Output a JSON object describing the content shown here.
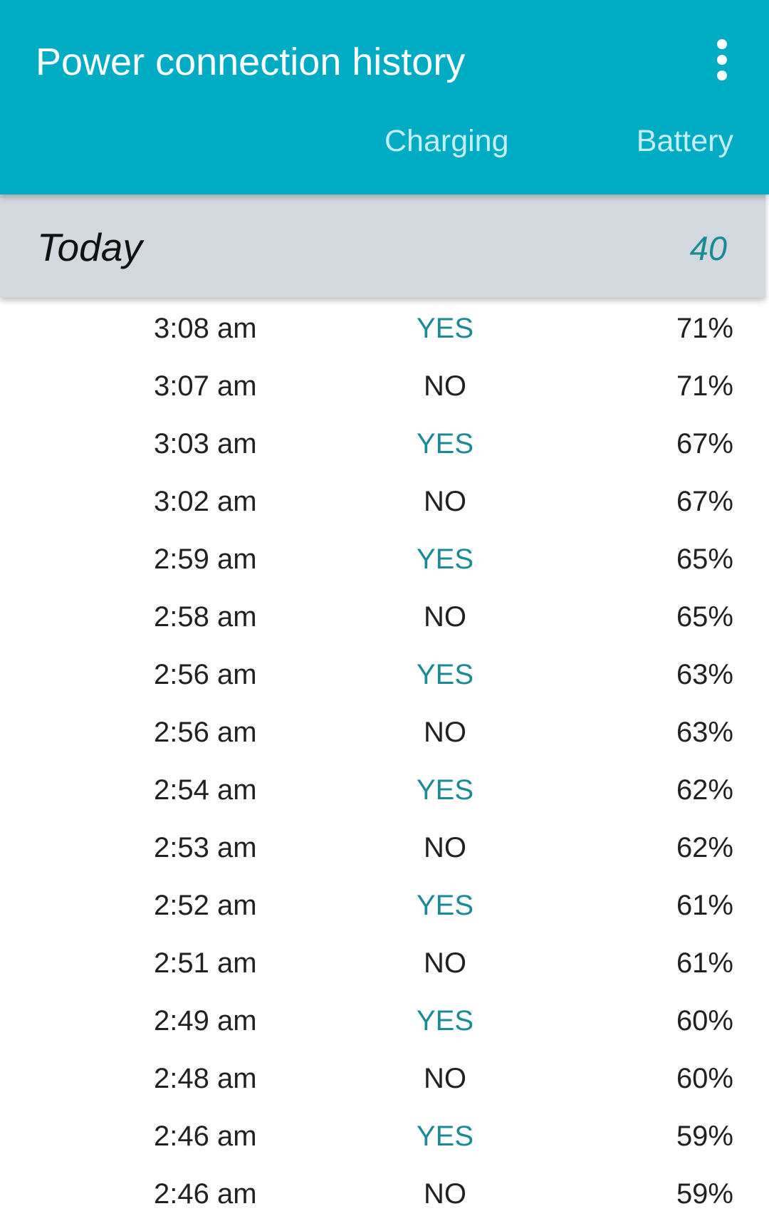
{
  "appbar": {
    "title": "Power connection history",
    "menu_icon": "more-vert-icon",
    "columns": {
      "charging": "Charging",
      "battery": "Battery"
    }
  },
  "colors": {
    "appbar": "#00acc4",
    "section_bg": "#d1d8de",
    "accent": "#1c8a96"
  },
  "section": {
    "title": "Today",
    "count": "40"
  },
  "rows": [
    {
      "time": "3:08 am",
      "charging": "YES",
      "battery": "71%"
    },
    {
      "time": "3:07 am",
      "charging": "NO",
      "battery": "71%"
    },
    {
      "time": "3:03 am",
      "charging": "YES",
      "battery": "67%"
    },
    {
      "time": "3:02 am",
      "charging": "NO",
      "battery": "67%"
    },
    {
      "time": "2:59 am",
      "charging": "YES",
      "battery": "65%"
    },
    {
      "time": "2:58 am",
      "charging": "NO",
      "battery": "65%"
    },
    {
      "time": "2:56 am",
      "charging": "YES",
      "battery": "63%"
    },
    {
      "time": "2:56 am",
      "charging": "NO",
      "battery": "63%"
    },
    {
      "time": "2:54 am",
      "charging": "YES",
      "battery": "62%"
    },
    {
      "time": "2:53 am",
      "charging": "NO",
      "battery": "62%"
    },
    {
      "time": "2:52 am",
      "charging": "YES",
      "battery": "61%"
    },
    {
      "time": "2:51 am",
      "charging": "NO",
      "battery": "61%"
    },
    {
      "time": "2:49 am",
      "charging": "YES",
      "battery": "60%"
    },
    {
      "time": "2:48 am",
      "charging": "NO",
      "battery": "60%"
    },
    {
      "time": "2:46 am",
      "charging": "YES",
      "battery": "59%"
    },
    {
      "time": "2:46 am",
      "charging": "NO",
      "battery": "59%"
    }
  ]
}
